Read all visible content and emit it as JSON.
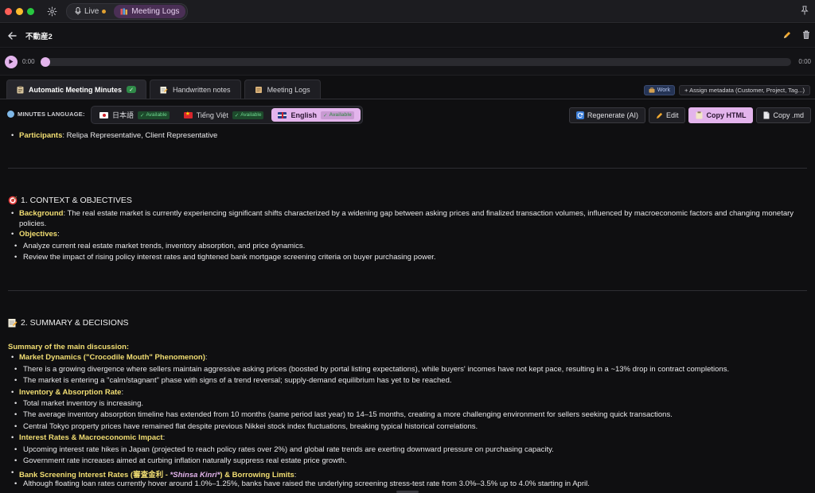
{
  "titlebar": {
    "modes": [
      {
        "label": "Live"
      },
      {
        "label": "Meeting Logs"
      }
    ]
  },
  "header": {
    "title": "不動産2"
  },
  "player": {
    "current_time": "0:00",
    "total_time": "0:00",
    "progress": 0
  },
  "tabs": [
    {
      "label": "Automatic Meeting Minutes",
      "active": true
    },
    {
      "label": "Handwritten notes",
      "active": false
    },
    {
      "label": "Meeting Logs",
      "active": false
    }
  ],
  "meta": {
    "tag": "Work",
    "assign_label": "+ Assign metadata (Customer, Project, Tag...)"
  },
  "language_bar": {
    "label": "MINUTES LANGUAGE:",
    "languages": [
      {
        "name": "日本語",
        "status": "Available",
        "active": false
      },
      {
        "name": "Tiếng Việt",
        "status": "Available",
        "active": false
      },
      {
        "name": "English",
        "status": "Available",
        "active": true
      }
    ]
  },
  "actions": {
    "regenerate": "Regenerate (AI)",
    "edit": "Edit",
    "copy_html": "Copy HTML",
    "copy_md": "Copy .md"
  },
  "minutes": {
    "participants_label": "Participants",
    "participants_text": ": Relipa Representative, Client Representative",
    "section1": {
      "icon": "target-icon",
      "title": "1. CONTEXT & OBJECTIVES",
      "background_label": "Background",
      "background_text": ": The real estate market is currently experiencing significant shifts characterized by a widening gap between asking prices and finalized transaction volumes, influenced by macroeconomic factors and changing monetary policies.",
      "objectives_label": "Objectives",
      "objectives": [
        "Analyze current real estate market trends, inventory absorption, and price dynamics.",
        "Review the impact of rising policy interest rates and tightened bank mortgage screening criteria on buyer purchasing power."
      ]
    },
    "section2": {
      "icon": "memo-icon",
      "title": "2. SUMMARY & DECISIONS",
      "summary_label": "Summary of the main discussion",
      "topics": [
        {
          "label": "Market Dynamics (\"Crocodile Mouth\" Phenomenon)",
          "points": [
            "There is a growing divergence where sellers maintain aggressive asking prices (boosted by portal listing expectations), while buyers' incomes have not kept pace, resulting in a ~13% drop in contract completions.",
            "The market is entering a \"calm/stagnant\" phase with signs of a trend reversal; supply-demand equilibrium has yet to be reached."
          ]
        },
        {
          "label": "Inventory & Absorption Rate",
          "points": [
            "Total market inventory is increasing.",
            "The average inventory absorption timeline has extended from 10 months (same period last year) to 14–15 months, creating a more challenging environment for sellers seeking quick transactions.",
            "Central Tokyo property prices have remained flat despite previous Nikkei stock index fluctuations, breaking typical historical correlations."
          ]
        },
        {
          "label": "Interest Rates & Macroeconomic Impact",
          "points": [
            "Upcoming interest rate hikes in Japan (projected to reach policy rates over 2%) and global rate trends are exerting downward pressure on purchasing capacity.",
            "Government rate increases aimed at curbing inflation naturally suppress real estate price growth."
          ]
        },
        {
          "label_prefix": "Bank Screening Interest Rates (",
          "label_ja": "審査金利",
          "label_dash": " - ",
          "label_italic": "*Shinsa Kinri*",
          "label_suffix": ") & Borrowing Limits",
          "points": [
            "Although floating loan rates currently hover around 1.0%–1.25%, banks have raised the underlying screening stress-test rate from 3.0%–3.5% up to 4.0% starting in April."
          ]
        }
      ]
    }
  }
}
